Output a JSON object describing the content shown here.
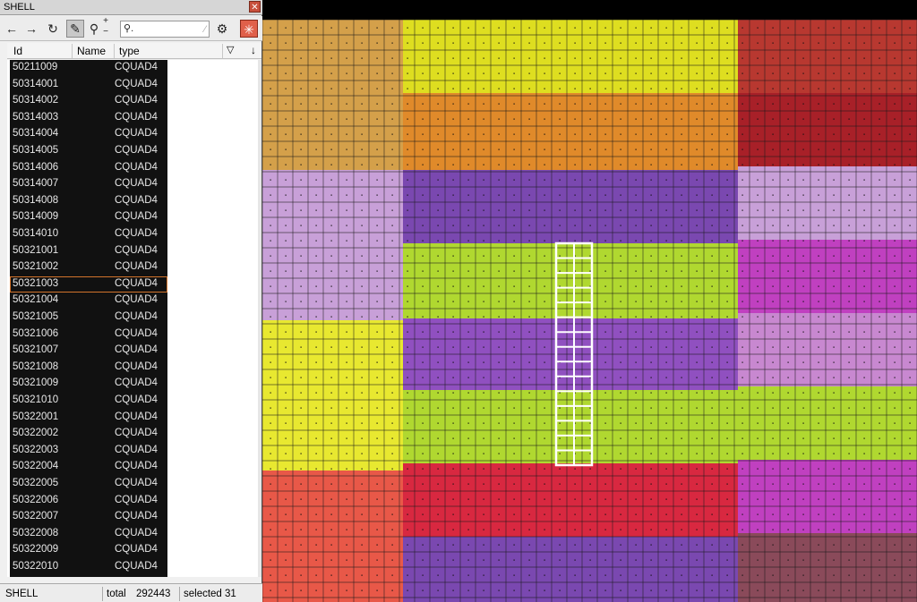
{
  "window": {
    "title": "SHELL",
    "close_glyph": "✕"
  },
  "toolbar": {
    "back_glyph": "←",
    "forward_glyph": "→",
    "refresh_glyph": "↻",
    "pick_glyph": "✎",
    "zoom_glyph": "⚲",
    "plus_glyph": "+",
    "minus_glyph": "−",
    "search_glyph": "⚲",
    "search_value": ".",
    "search_clear_glyph": "⁄",
    "settings_glyph": "⚙",
    "clear_selection_glyph": "✳"
  },
  "table": {
    "columns": [
      "Id",
      "Name",
      "type"
    ],
    "filter_glyph": "▽",
    "sort_glyph": "↓",
    "rows": [
      {
        "id": "50211009",
        "type": "CQUAD4"
      },
      {
        "id": "50314001",
        "type": "CQUAD4"
      },
      {
        "id": "50314002",
        "type": "CQUAD4"
      },
      {
        "id": "50314003",
        "type": "CQUAD4"
      },
      {
        "id": "50314004",
        "type": "CQUAD4"
      },
      {
        "id": "50314005",
        "type": "CQUAD4"
      },
      {
        "id": "50314006",
        "type": "CQUAD4"
      },
      {
        "id": "50314007",
        "type": "CQUAD4"
      },
      {
        "id": "50314008",
        "type": "CQUAD4"
      },
      {
        "id": "50314009",
        "type": "CQUAD4"
      },
      {
        "id": "50314010",
        "type": "CQUAD4"
      },
      {
        "id": "50321001",
        "type": "CQUAD4"
      },
      {
        "id": "50321002",
        "type": "CQUAD4"
      },
      {
        "id": "50321003",
        "type": "CQUAD4",
        "focused": true
      },
      {
        "id": "50321004",
        "type": "CQUAD4"
      },
      {
        "id": "50321005",
        "type": "CQUAD4"
      },
      {
        "id": "50321006",
        "type": "CQUAD4"
      },
      {
        "id": "50321007",
        "type": "CQUAD4"
      },
      {
        "id": "50321008",
        "type": "CQUAD4"
      },
      {
        "id": "50321009",
        "type": "CQUAD4"
      },
      {
        "id": "50321010",
        "type": "CQUAD4"
      },
      {
        "id": "50322001",
        "type": "CQUAD4"
      },
      {
        "id": "50322002",
        "type": "CQUAD4"
      },
      {
        "id": "50322003",
        "type": "CQUAD4"
      },
      {
        "id": "50322004",
        "type": "CQUAD4"
      },
      {
        "id": "50322005",
        "type": "CQUAD4"
      },
      {
        "id": "50322006",
        "type": "CQUAD4"
      },
      {
        "id": "50322007",
        "type": "CQUAD4"
      },
      {
        "id": "50322008",
        "type": "CQUAD4"
      },
      {
        "id": "50322009",
        "type": "CQUAD4"
      },
      {
        "id": "50322010",
        "type": "CQUAD4"
      }
    ]
  },
  "status": {
    "name": "SHELL",
    "total_label": "total",
    "total_value": "292443",
    "selected_text": "selected 31"
  },
  "mesh": {
    "colors": {
      "ochre": "#d4a04a",
      "yellow": "#dede20",
      "orange": "#e08a2a",
      "lavender": "#c8a0d8",
      "violet": "#7a48b0",
      "lime": "#b0d830",
      "bright_yellow": "#e8e830",
      "purple": "#9050c0",
      "light_purple": "#b478d4",
      "magenta": "#c040c0",
      "pink_purple": "#c888d0",
      "coral": "#e85848",
      "red": "#d82840",
      "brown_red": "#b83830",
      "dark_red": "#a82028",
      "mauve": "#8a4a5a",
      "selection": "#ffffff"
    },
    "selected_elements": 31
  }
}
